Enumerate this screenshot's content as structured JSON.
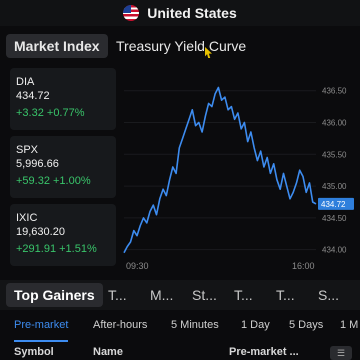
{
  "header": {
    "country": "United States",
    "flag_icon": "us-flag-icon"
  },
  "tabs": [
    {
      "label": "Market Index",
      "active": true
    },
    {
      "label": "Treasury Yield Curve",
      "active": false
    }
  ],
  "indices": [
    {
      "symbol": "DIA",
      "price": "434.72",
      "change": "+3.32 +0.77%"
    },
    {
      "symbol": "SPX",
      "price": "5,996.66",
      "change": "+59.32 +1.00%"
    },
    {
      "symbol": "IXIC",
      "price": "19,630.20",
      "change": "+291.91 +1.51%"
    }
  ],
  "colors": {
    "line": "#3d8cf0",
    "gain": "#39c46a",
    "price_tag": "#2f7fdc"
  },
  "chart_data": {
    "type": "line",
    "symbol": "DIA",
    "x_ticks": [
      "09:30",
      "16:00"
    ],
    "y_ticks": [
      "436.50",
      "436.00",
      "435.50",
      "435.00",
      "434.50",
      "434.00"
    ],
    "ylim": [
      433.9,
      436.7
    ],
    "last_price_label": "434.72",
    "series": [
      {
        "values": [
          433.95,
          434.05,
          434.12,
          434.3,
          434.22,
          434.38,
          434.5,
          434.42,
          434.6,
          434.7,
          434.55,
          434.8,
          434.95,
          434.85,
          435.1,
          435.3,
          435.2,
          435.6,
          435.75,
          435.9,
          436.05,
          436.2,
          435.95,
          436.0,
          435.85,
          436.1,
          436.3,
          436.25,
          436.45,
          436.55,
          436.35,
          436.4,
          436.2,
          436.25,
          436.05,
          436.15,
          435.9,
          436.0,
          435.7,
          435.85,
          435.6,
          435.4,
          435.55,
          435.3,
          435.45,
          435.2,
          435.35,
          435.1,
          434.95,
          435.2,
          435.0,
          434.8,
          434.9,
          435.05,
          435.25,
          435.15,
          434.9,
          435.05,
          434.75,
          434.72
        ]
      }
    ]
  },
  "movers_tabs": [
    "Top Gainers",
    "T...",
    "M...",
    "St...",
    "T...",
    "T...",
    "S..."
  ],
  "sessions": [
    "Pre-market",
    "After-hours",
    "5 Minutes",
    "1 Day",
    "5 Days",
    "1 M"
  ],
  "table_headers": [
    "Symbol",
    "Name",
    "Pre-market ..."
  ]
}
